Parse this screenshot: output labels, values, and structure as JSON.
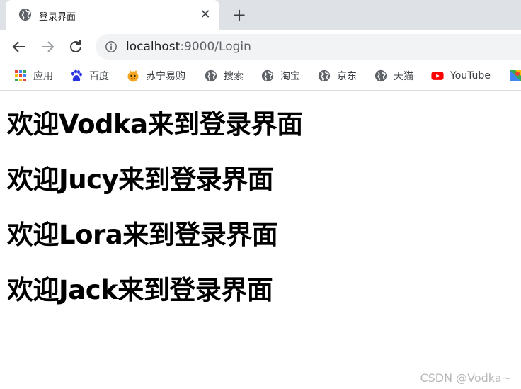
{
  "tab": {
    "title": "登录界面",
    "close_symbol": "✕",
    "new_tab_symbol": "+"
  },
  "toolbar": {
    "back_icon": "back-arrow-icon",
    "forward_icon": "forward-arrow-icon",
    "reload_icon": "reload-icon",
    "url_host": "localhost",
    "url_rest": ":9000/Login"
  },
  "bookmarks": [
    {
      "label": "应用",
      "icon": "apps-grid-icon"
    },
    {
      "label": "百度",
      "icon": "baidu-paw-icon"
    },
    {
      "label": "苏宁易购",
      "icon": "suning-icon"
    },
    {
      "label": "搜索",
      "icon": "globe-icon"
    },
    {
      "label": "淘宝",
      "icon": "globe-icon"
    },
    {
      "label": "京东",
      "icon": "globe-icon"
    },
    {
      "label": "天猫",
      "icon": "globe-icon"
    },
    {
      "label": "YouTube",
      "icon": "youtube-icon"
    }
  ],
  "content": {
    "headings": [
      "欢迎Vodka来到登录界面",
      "欢迎Jucy来到登录界面",
      "欢迎Lora来到登录界面",
      "欢迎Jack来到登录界面"
    ]
  },
  "watermark": "CSDN @Vodka~",
  "colors": {
    "tabstrip_bg": "#dee1e6",
    "omnibox_bg": "#f1f3f4",
    "youtube_red": "#ff0000",
    "baidu_blue": "#2932e1"
  }
}
